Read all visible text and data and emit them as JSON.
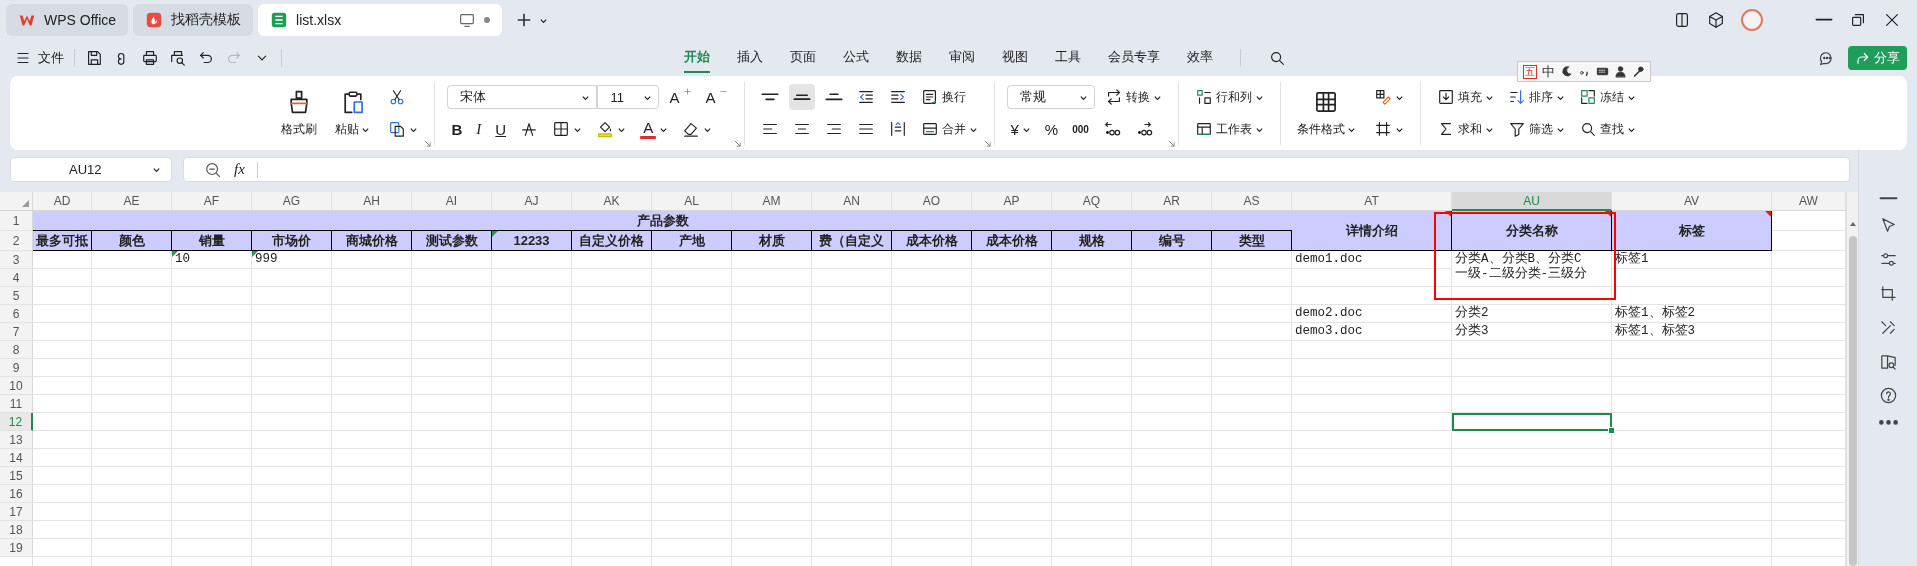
{
  "tabs": [
    {
      "label": "WPS Office",
      "kind": "wps",
      "selected": false
    },
    {
      "label": "找稻壳模板",
      "kind": "docer",
      "selected": false
    },
    {
      "label": "list.xlsx",
      "kind": "spreadsheet",
      "selected": true,
      "unsaved": true
    }
  ],
  "title_tools": [
    {
      "kind": "panel"
    },
    {
      "kind": "cube"
    },
    {
      "kind": "avatar"
    }
  ],
  "window_controls": [
    {
      "kind": "minimize"
    },
    {
      "kind": "restore"
    },
    {
      "kind": "close"
    }
  ],
  "file_menu": "文件",
  "quick_access": [
    {
      "kind": "save",
      "disabled": false
    },
    {
      "kind": "link",
      "disabled": false
    },
    {
      "kind": "print",
      "disabled": false
    },
    {
      "kind": "preview",
      "disabled": false
    },
    {
      "kind": "undo",
      "disabled": false
    },
    {
      "kind": "redo",
      "disabled": true
    },
    {
      "kind": "more",
      "disabled": false
    }
  ],
  "menu_tabs": [
    {
      "label": "开始",
      "selected": true
    },
    {
      "label": "插入",
      "selected": false
    },
    {
      "label": "页面",
      "selected": false
    },
    {
      "label": "公式",
      "selected": false
    },
    {
      "label": "数据",
      "selected": false
    },
    {
      "label": "审阅",
      "selected": false
    },
    {
      "label": "视图",
      "selected": false
    },
    {
      "label": "工具",
      "selected": false
    },
    {
      "label": "会员专享",
      "selected": false
    },
    {
      "label": "效率",
      "selected": false
    }
  ],
  "share_button": "分享",
  "ime_toolbar": [
    {
      "kind": "char",
      "text": "五",
      "boxed": true
    },
    {
      "kind": "char",
      "text": "中",
      "boxed": false
    },
    {
      "kind": "moon"
    },
    {
      "kind": "punctuation"
    },
    {
      "kind": "keyboard"
    },
    {
      "kind": "user"
    },
    {
      "kind": "wrench"
    }
  ],
  "ribbon": [
    {
      "kind": "columns",
      "launcher": true,
      "lines": [
        [
          {
            "kind": "format-painter",
            "label": "格式刷"
          }
        ],
        [
          {
            "kind": "paste",
            "label": "粘贴",
            "dropdown": true
          }
        ],
        [
          {
            "kind": "cut"
          },
          {
            "kind": "copy-format",
            "dropdown": true
          }
        ]
      ]
    },
    {
      "kind": "rows",
      "launcher": true,
      "lines": [
        [
          {
            "kind": "font-select",
            "value": "宋体"
          },
          {
            "kind": "size-select",
            "value": "11"
          },
          {
            "kind": "grow-font",
            "glyph": "A"
          },
          {
            "kind": "shrink-font",
            "glyph": "A"
          }
        ],
        [
          {
            "kind": "bold",
            "glyph": "B"
          },
          {
            "kind": "italic",
            "glyph": "I"
          },
          {
            "kind": "underline",
            "glyph": "U"
          },
          {
            "kind": "strikethrough"
          },
          {
            "kind": "borders",
            "dropdown": true
          },
          {
            "kind": "fill-color",
            "dropdown": true
          },
          {
            "kind": "font-color",
            "glyph": "A",
            "dropdown": true
          },
          {
            "kind": "clear",
            "dropdown": true
          }
        ]
      ]
    },
    {
      "kind": "rows",
      "launcher": true,
      "lines": [
        [
          {
            "kind": "align-top",
            "selected": false
          },
          {
            "kind": "align-middle",
            "selected": true
          },
          {
            "kind": "align-bottom",
            "selected": false
          },
          {
            "kind": "outdent"
          },
          {
            "kind": "indent"
          },
          {
            "kind": "wrap",
            "label": "换行"
          }
        ],
        [
          {
            "kind": "align-left",
            "selected": false
          },
          {
            "kind": "align-center",
            "selected": false
          },
          {
            "kind": "align-right",
            "selected": false
          },
          {
            "kind": "justify",
            "selected": false
          },
          {
            "kind": "distribute",
            "selected": false
          },
          {
            "kind": "merge",
            "label": "合并",
            "dropdown": true
          }
        ]
      ]
    },
    {
      "kind": "rows",
      "launcher": true,
      "lines": [
        [
          {
            "kind": "number-select",
            "value": "常规"
          },
          {
            "kind": "convert",
            "label": "转换",
            "dropdown": true
          }
        ],
        [
          {
            "kind": "currency",
            "glyph": "¥",
            "dropdown": true
          },
          {
            "kind": "percent",
            "glyph": "%"
          },
          {
            "kind": "thousands",
            "glyph": "000"
          },
          {
            "kind": "decimal-increase"
          },
          {
            "kind": "decimal-decrease"
          }
        ]
      ]
    },
    {
      "kind": "rows",
      "lines": [
        [
          {
            "kind": "rows-columns",
            "label": "行和列",
            "dropdown": true
          }
        ],
        [
          {
            "kind": "worksheet",
            "label": "工作表",
            "dropdown": true
          }
        ]
      ]
    },
    {
      "kind": "columns",
      "lines": [
        [
          {
            "kind": "conditional-format",
            "label": "条件格式",
            "dropdown": true
          }
        ],
        [
          {
            "kind": "cell-style",
            "dropdown": true
          },
          {
            "kind": "cell-border",
            "dropdown": true
          }
        ]
      ]
    },
    {
      "kind": "rows",
      "lines": [
        [
          {
            "kind": "fill",
            "label": "填充",
            "dropdown": true
          },
          {
            "kind": "sort",
            "label": "排序",
            "dropdown": true
          },
          {
            "kind": "freeze",
            "label": "冻结",
            "dropdown": true
          }
        ],
        [
          {
            "kind": "sum",
            "label": "求和",
            "dropdown": true
          },
          {
            "kind": "filter",
            "label": "筛选",
            "dropdown": true
          },
          {
            "kind": "find",
            "label": "查找",
            "dropdown": true
          }
        ]
      ]
    }
  ],
  "name_box": "AU12",
  "formula_label": "fx",
  "side_panel": [
    {
      "kind": "collapse"
    },
    {
      "kind": "pointer"
    },
    {
      "kind": "sliders"
    },
    {
      "kind": "frame"
    },
    {
      "kind": "tools"
    },
    {
      "kind": "book"
    },
    {
      "kind": "help"
    },
    {
      "kind": "more"
    }
  ],
  "annotation": {
    "kind": "rectangle"
  },
  "sheet": {
    "columns": [
      {
        "label": "AD",
        "selected": false
      },
      {
        "label": "AE",
        "selected": false
      },
      {
        "label": "AF",
        "selected": false
      },
      {
        "label": "AG",
        "selected": false
      },
      {
        "label": "AH",
        "selected": false
      },
      {
        "label": "AI",
        "selected": false
      },
      {
        "label": "AJ",
        "selected": false
      },
      {
        "label": "AK",
        "selected": false
      },
      {
        "label": "AL",
        "selected": false
      },
      {
        "label": "AM",
        "selected": false
      },
      {
        "label": "AN",
        "selected": false
      },
      {
        "label": "AO",
        "selected": false
      },
      {
        "label": "AP",
        "selected": false
      },
      {
        "label": "AQ",
        "selected": false
      },
      {
        "label": "AR",
        "selected": false
      },
      {
        "label": "AS",
        "selected": false
      },
      {
        "label": "AT",
        "selected": false
      },
      {
        "label": "AU",
        "selected": true
      },
      {
        "label": "AV",
        "selected": false
      },
      {
        "label": "AW",
        "selected": false
      }
    ],
    "group_title": "产品参数",
    "fields": [
      {
        "text": "最多可抵",
        "warning": false
      },
      {
        "text": "颜色",
        "warning": false
      },
      {
        "text": "销量",
        "warning": false
      },
      {
        "text": "市场价",
        "warning": false
      },
      {
        "text": "商城价格",
        "warning": false
      },
      {
        "text": "测试参数",
        "warning": false
      },
      {
        "text": "12233",
        "warning": true
      },
      {
        "text": "自定义价格",
        "warning": false
      },
      {
        "text": "产地",
        "warning": false
      },
      {
        "text": "材质",
        "warning": false
      },
      {
        "text": "费（自定义",
        "warning": false
      },
      {
        "text": "成本价格",
        "warning": false
      },
      {
        "text": "成本价格",
        "warning": false
      },
      {
        "text": "规格",
        "warning": false
      },
      {
        "text": "编号",
        "warning": false
      },
      {
        "text": "类型",
        "warning": false
      }
    ],
    "side_fields": [
      {
        "text": "详情介绍",
        "comment": true
      },
      {
        "text": "分类名称",
        "comment": true
      },
      {
        "text": "标签",
        "comment": true
      }
    ],
    "rows": [
      {
        "label": "1",
        "selected": false
      },
      {
        "label": "2",
        "selected": false
      },
      {
        "label": "3",
        "selected": false,
        "cells": [
          null,
          null,
          {
            "lines": [
              "10"
            ],
            "warning": true
          },
          {
            "lines": [
              "999"
            ],
            "warning": true
          },
          null,
          null,
          null,
          null,
          null,
          null,
          null,
          null,
          null,
          null,
          null,
          null,
          {
            "lines": [
              "demo1.doc"
            ],
            "warning": false
          },
          {
            "lines": [
              "分类A、分类B、分类C",
              "一级-二级分类-三级分"
            ],
            "warning": false
          },
          {
            "lines": [
              "标签1"
            ],
            "warning": false
          },
          null
        ]
      },
      {
        "label": "4",
        "selected": false
      },
      {
        "label": "5",
        "selected": false
      },
      {
        "label": "6",
        "selected": false,
        "cells": [
          null,
          null,
          null,
          null,
          null,
          null,
          null,
          null,
          null,
          null,
          null,
          null,
          null,
          null,
          null,
          null,
          {
            "lines": [
              "demo2.doc"
            ],
            "warning": false
          },
          {
            "lines": [
              "分类2"
            ],
            "warning": false
          },
          {
            "lines": [
              "标签1、标签2"
            ],
            "warning": false
          },
          null
        ]
      },
      {
        "label": "7",
        "selected": false,
        "cells": [
          null,
          null,
          null,
          null,
          null,
          null,
          null,
          null,
          null,
          null,
          null,
          null,
          null,
          null,
          null,
          null,
          {
            "lines": [
              "demo3.doc"
            ],
            "warning": false
          },
          {
            "lines": [
              "分类3"
            ],
            "warning": false
          },
          {
            "lines": [
              "标签1、标签3"
            ],
            "warning": false
          },
          null
        ]
      },
      {
        "label": "8",
        "selected": false
      },
      {
        "label": "9",
        "selected": false
      },
      {
        "label": "10",
        "selected": false
      },
      {
        "label": "11",
        "selected": false
      },
      {
        "label": "12",
        "selected": true
      },
      {
        "label": "13",
        "selected": false
      },
      {
        "label": "14",
        "selected": false
      },
      {
        "label": "15",
        "selected": false
      },
      {
        "label": "16",
        "selected": false
      },
      {
        "label": "17",
        "selected": false
      },
      {
        "label": "18",
        "selected": false
      },
      {
        "label": "19",
        "selected": false
      }
    ]
  }
}
